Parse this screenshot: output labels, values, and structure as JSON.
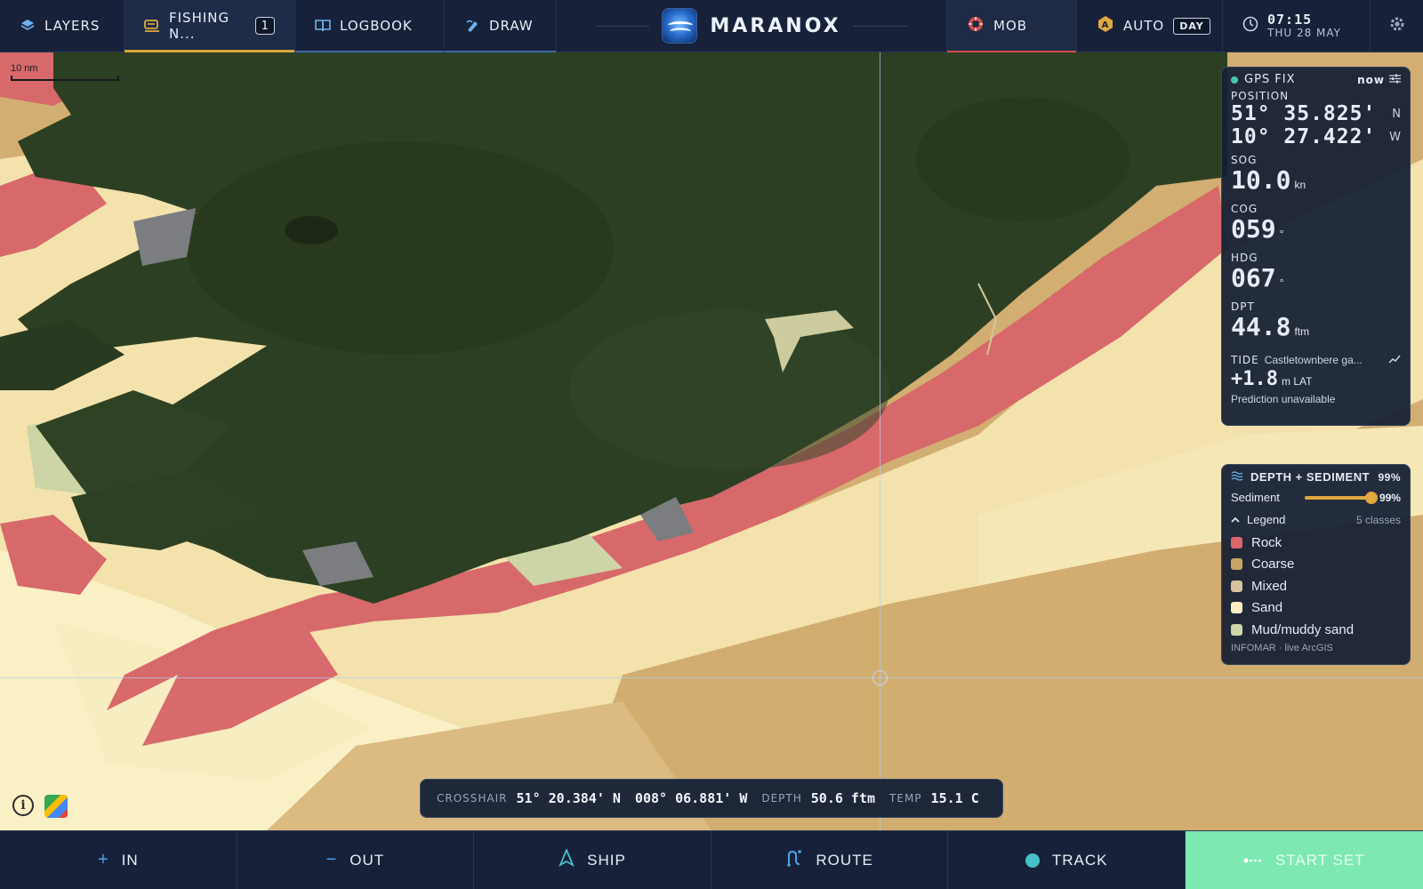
{
  "topbar": {
    "tabs": [
      {
        "label": "LAYERS",
        "icon": "layers-icon"
      },
      {
        "label": "FISHING N...",
        "icon": "fishing-icon",
        "badge": "1"
      },
      {
        "label": "LOGBOOK",
        "icon": "book-icon"
      },
      {
        "label": "DRAW",
        "icon": "draw-icon"
      }
    ],
    "brand": "MARANOX",
    "mob_label": "MOB",
    "auto_label": "AUTO",
    "day_label": "DAY",
    "time": "07:15",
    "date": "THU 28 MAY"
  },
  "map": {
    "scale_label": "10 nm"
  },
  "gps": {
    "title": "GPS FIX",
    "freshness": "now",
    "position_label": "POSITION",
    "lat": "51° 35.825'",
    "lat_hem": "N",
    "lon": "10° 27.422'",
    "lon_hem": "W",
    "sog_label": "SOG",
    "sog": "10.0",
    "sog_unit": "kn",
    "cog_label": "COG",
    "cog": "059",
    "cog_unit": "°",
    "hdg_label": "HDG",
    "hdg": "067",
    "hdg_unit": "°",
    "dpt_label": "DPT",
    "dpt": "44.8",
    "dpt_unit": "ftm",
    "tide_label": "TIDE",
    "tide_location": "Castletownbere ga...",
    "tide_value": "+1.8",
    "tide_unit": "m LAT",
    "tide_note": "Prediction unavailable"
  },
  "legend": {
    "title": "DEPTH + SEDIMENT",
    "title_pct": "99%",
    "slider_label": "Sediment",
    "slider_value": 0.99,
    "slider_pct": "99%",
    "toggle_label": "Legend",
    "class_count": "5 classes",
    "items": [
      {
        "label": "Rock",
        "color": "#d9686a"
      },
      {
        "label": "Coarse",
        "color": "#c9a56a"
      },
      {
        "label": "Mixed",
        "color": "#d7c2a0"
      },
      {
        "label": "Sand",
        "color": "#f8f0c4"
      },
      {
        "label": "Mud/muddy sand",
        "color": "#cfd6a8"
      }
    ],
    "source": "INFOMAR · live ArcGIS"
  },
  "readout": {
    "crosshair_label": "CROSSHAIR",
    "lat": "51° 20.384' N",
    "lon": "008° 06.881' W",
    "depth_label": "DEPTH",
    "depth": "50.6 ftm",
    "temp_label": "TEMP",
    "temp": "15.1 C"
  },
  "bottombar": {
    "buttons": [
      {
        "label": "IN",
        "icon": "plus-icon"
      },
      {
        "label": "OUT",
        "icon": "minus-icon"
      },
      {
        "label": "SHIP",
        "icon": "ship-icon"
      },
      {
        "label": "ROUTE",
        "icon": "route-icon"
      },
      {
        "label": "TRACK",
        "icon": "track-icon"
      },
      {
        "label": "START SET",
        "icon": "start-set-icon"
      }
    ]
  },
  "colors": {
    "accent": "#d8a53d",
    "mob": "#d24b4b",
    "start_set": "#7ee8b3",
    "land": "#2c3d22",
    "teal": "#46c9b6"
  }
}
